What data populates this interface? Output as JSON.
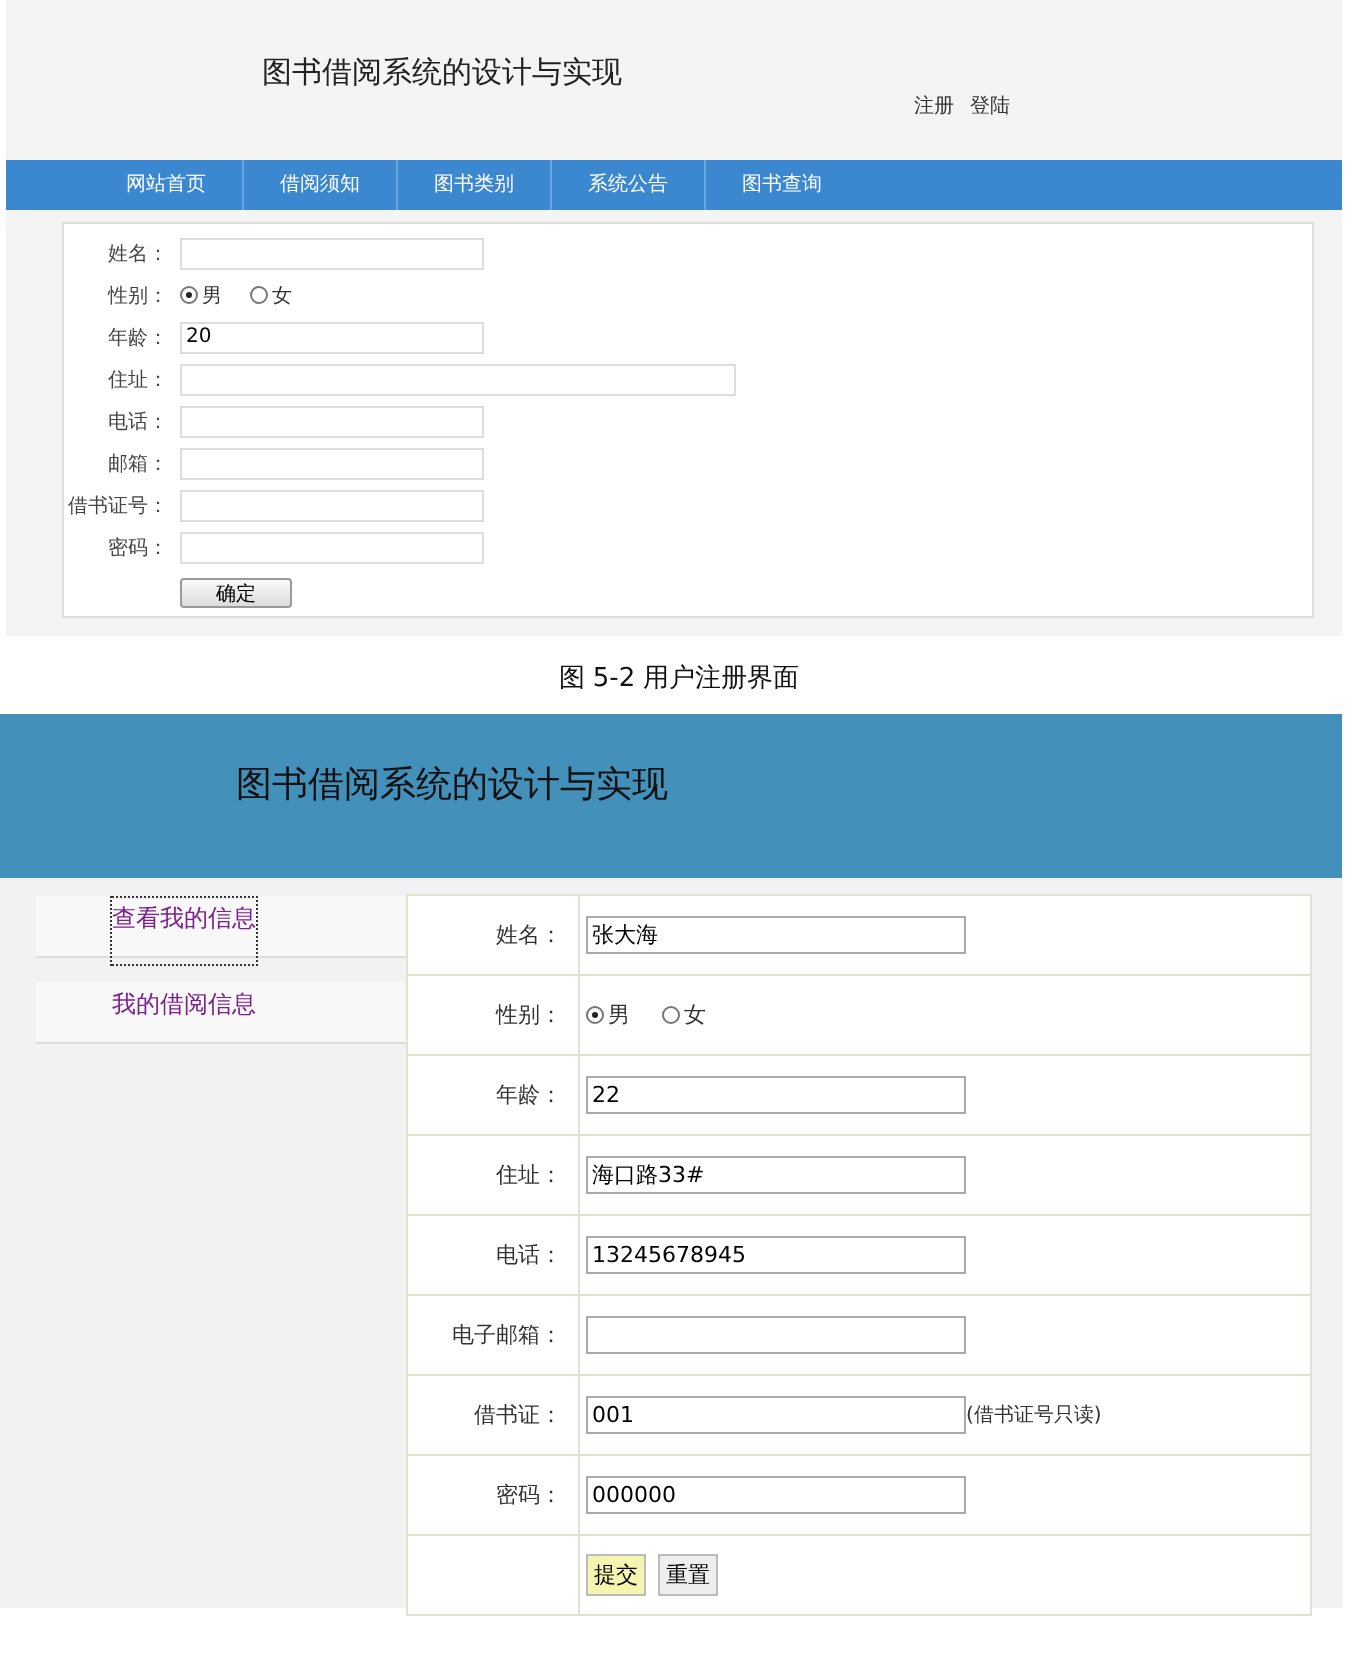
{
  "top_screen": {
    "header": {
      "title": "图书借阅系统的设计与实现",
      "links": [
        {
          "label": "注册"
        },
        {
          "label": "登陆"
        }
      ]
    },
    "nav": [
      {
        "label": "网站首页"
      },
      {
        "label": "借阅须知"
      },
      {
        "label": "图书类别"
      },
      {
        "label": "系统公告"
      },
      {
        "label": "图书查询"
      }
    ],
    "form": {
      "rows": [
        {
          "label": "姓名：",
          "kind": "text"
        },
        {
          "label": "性别：",
          "kind": "radio",
          "options": [
            {
              "label": "男",
              "selected": true
            },
            {
              "label": "女",
              "selected": false
            }
          ]
        },
        {
          "label": "年龄：",
          "kind": "text",
          "value": "20"
        },
        {
          "label": "住址：",
          "kind": "wide"
        },
        {
          "label": "电话：",
          "kind": "text"
        },
        {
          "label": "邮箱：",
          "kind": "text"
        },
        {
          "label": "借书证号：",
          "kind": "text"
        },
        {
          "label": "密码：",
          "kind": "text"
        }
      ],
      "button": "确定"
    }
  },
  "caption": "图 5-2 用户注册界面",
  "bottom_screen": {
    "title": "图书借阅系统的设计与实现",
    "sidebar": [
      {
        "label": "查看我的信息",
        "selected": true
      },
      {
        "label": "我的借阅信息",
        "selected": false
      }
    ],
    "form": {
      "rows": [
        {
          "label": "姓名：",
          "kind": "text",
          "value": "张大海"
        },
        {
          "label": "性别：",
          "kind": "radio",
          "options": [
            {
              "label": "男",
              "selected": true
            },
            {
              "label": "女",
              "selected": false
            }
          ]
        },
        {
          "label": "年龄：",
          "kind": "text",
          "value": "22"
        },
        {
          "label": "住址：",
          "kind": "text",
          "value": "海口路33#"
        },
        {
          "label": "电话：",
          "kind": "text",
          "value": "13245678945"
        },
        {
          "label": "电子邮箱：",
          "kind": "text"
        },
        {
          "label": "借书证：",
          "kind": "text",
          "value": "001",
          "note": "(借书证号只读)"
        },
        {
          "label": "密码：",
          "kind": "text",
          "value": "000000"
        }
      ],
      "buttons": [
        {
          "label": "提交",
          "kind": "submit"
        },
        {
          "label": "重置",
          "kind": "reset"
        }
      ]
    }
  }
}
